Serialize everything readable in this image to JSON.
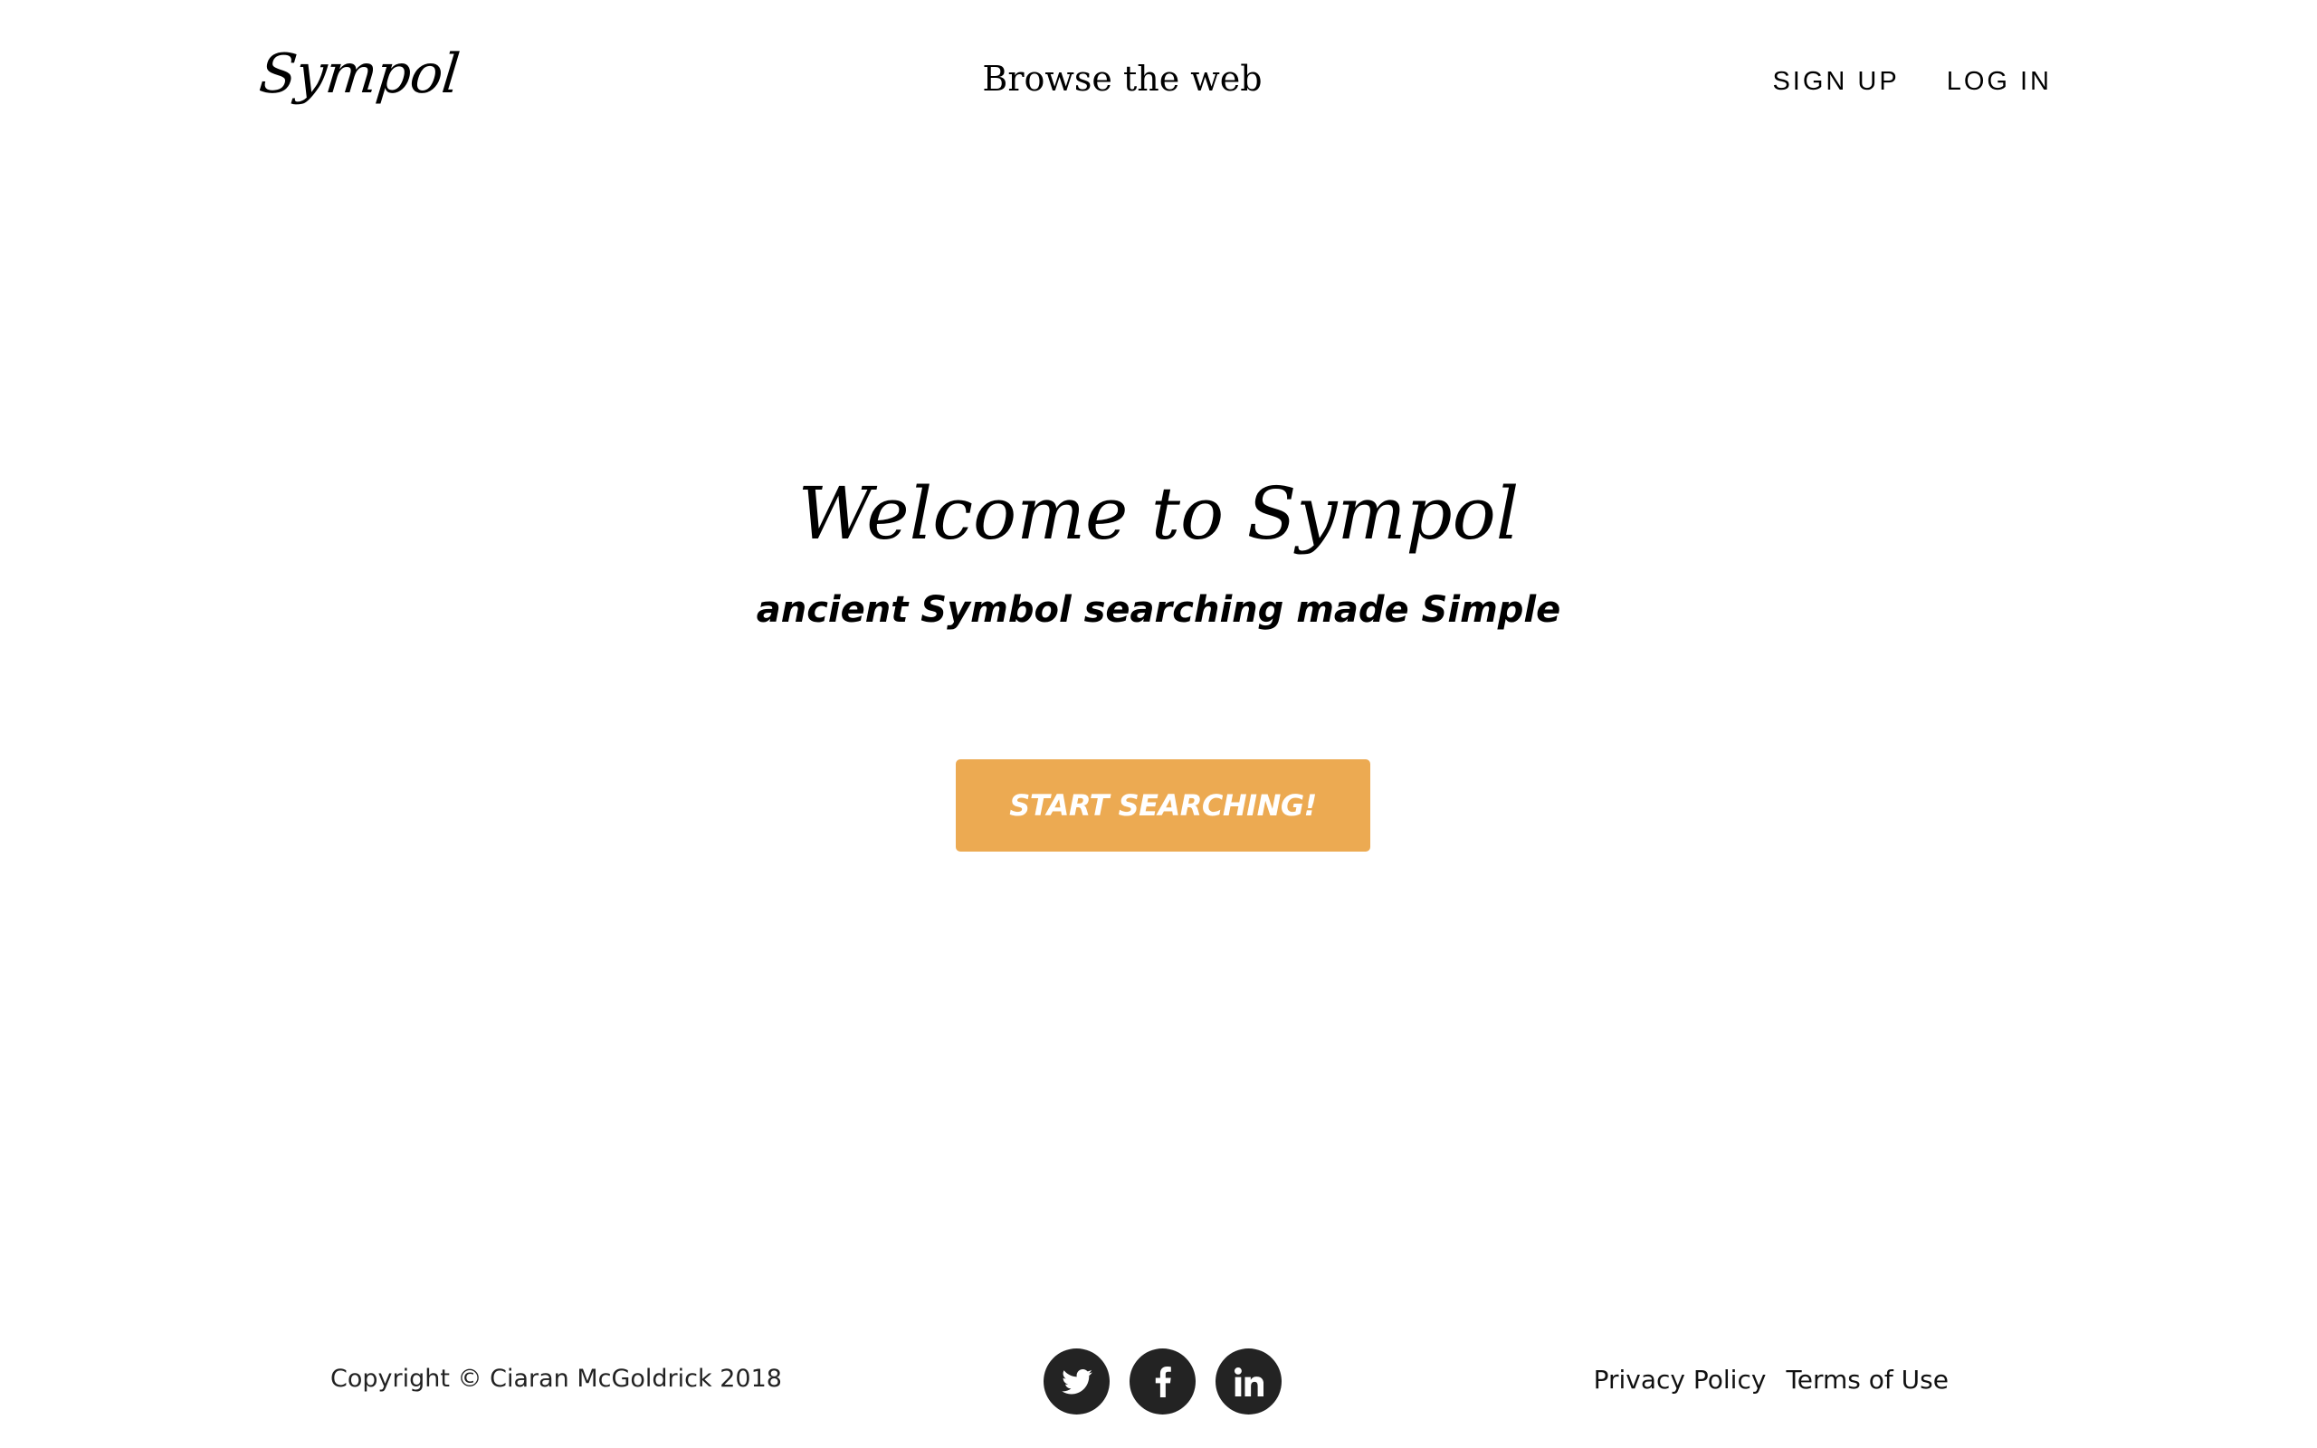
{
  "header": {
    "logo_text": "Sympol",
    "browse_label": "Browse the web",
    "nav": {
      "signup_label": "SIGN UP",
      "login_label": "LOG IN"
    }
  },
  "hero": {
    "title": "Welcome to Sympol",
    "subtitle": "ancient Symbol searching made Simple",
    "cta_label": "START SEARCHING!"
  },
  "footer": {
    "copyright": "Copyright © Ciaran McGoldrick 2018",
    "social": [
      {
        "icon": "twitter-icon"
      },
      {
        "icon": "facebook-icon"
      },
      {
        "icon": "linkedin-icon"
      }
    ],
    "links": {
      "privacy_label": "Privacy Policy",
      "terms_label": "Terms of Use"
    }
  },
  "colors": {
    "accent": "#ecaa52",
    "social_bg": "#232323",
    "text": "#000000",
    "background": "#ffffff"
  }
}
